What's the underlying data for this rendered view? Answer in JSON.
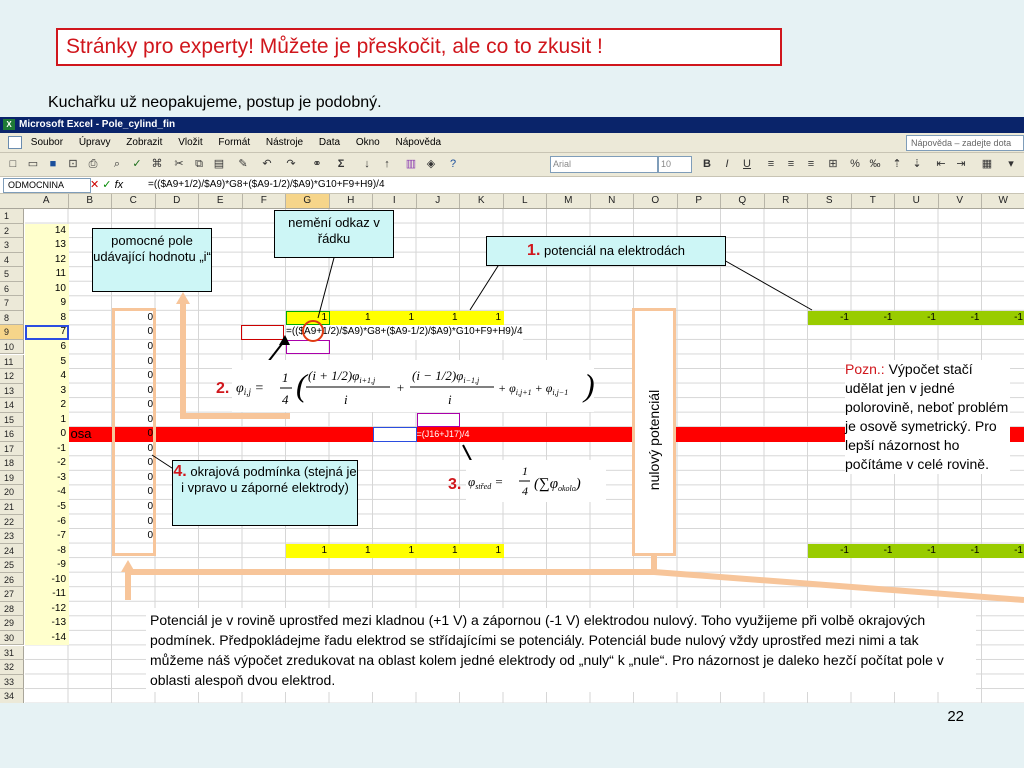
{
  "slide": {
    "title": "Stránky pro experty! Můžete je přeskočit, ale co to zkusit !",
    "subtitle": "Kuchařku už neopakujeme, postup je podobný.",
    "page_number": "22"
  },
  "excel": {
    "window_title": "Microsoft Excel - Pole_cylind_fin",
    "menu": [
      "Soubor",
      "Úpravy",
      "Zobrazit",
      "Vložit",
      "Formát",
      "Nástroje",
      "Data",
      "Okno",
      "Nápověda"
    ],
    "help_placeholder": "Nápověda – zadejte dota",
    "font_name": "Arial",
    "font_size": "10",
    "name_box": "ODMOCNINA",
    "formula": "=(($A9+1/2)/$A9)*G8+($A9-1/2)/$A9)*G10+F9+H9)/4",
    "columns": [
      "A",
      "B",
      "C",
      "D",
      "E",
      "F",
      "G",
      "H",
      "I",
      "J",
      "K",
      "L",
      "M",
      "N",
      "O",
      "P",
      "Q",
      "R",
      "S",
      "T",
      "U",
      "V",
      "W"
    ],
    "rows": [
      "1",
      "2",
      "3",
      "4",
      "5",
      "6",
      "7",
      "8",
      "9",
      "10",
      "11",
      "12",
      "13",
      "14",
      "15",
      "16",
      "17",
      "18",
      "19",
      "20",
      "21",
      "22",
      "23",
      "24",
      "25",
      "26",
      "27",
      "28",
      "29",
      "30",
      "31",
      "32",
      "33",
      "34"
    ],
    "col_a_values": [
      "",
      "14",
      "13",
      "12",
      "11",
      "10",
      "9",
      "8",
      "7",
      "6",
      "5",
      "4",
      "3",
      "2",
      "1",
      "0",
      "-1",
      "-2",
      "-3",
      "-4",
      "-5",
      "-6",
      "-7",
      "-8",
      "-9",
      "-10",
      "-11",
      "-12",
      "-13",
      "-14",
      "",
      "",
      "",
      ""
    ],
    "col_c_values": [
      "",
      "",
      "",
      "",
      "",
      "",
      "",
      "0",
      "0",
      "0",
      "0",
      "0",
      "0",
      "0",
      "0",
      "0",
      "0",
      "0",
      "0",
      "0",
      "0",
      "0",
      "0",
      "",
      "",
      "",
      "",
      "",
      "",
      "",
      "",
      "",
      "",
      ""
    ],
    "row8_ones": [
      "1",
      "1",
      "1",
      "1",
      "1"
    ],
    "row24_ones": [
      "1",
      "1",
      "1",
      "1",
      "1"
    ],
    "row8_minus": [
      "-1",
      "-1",
      "-1",
      "-1",
      "-1"
    ],
    "row24_minus": [
      "-1",
      "-1",
      "-1",
      "-1",
      "-1"
    ],
    "osa_label": "osa",
    "g9_formula": "=(($A9+1/2)/$A9)*G8+($A9-1/2)/$A9)*G10+F9+H9)/4",
    "j16_formula": "=(J16+J17)/4"
  },
  "annotations": {
    "helper": "pomocné pole udávající hodnotu „i“",
    "row_ref": "nemění odkaz v řádku",
    "potential_num": "1.",
    "potential": "potenciál na elektrodách",
    "eq2_num": "2.",
    "eq3_num": "3.",
    "boundary_num": "4.",
    "boundary": "okrajová podmínka (stejná je i vpravo u záporné elektrody)",
    "zero_potential": "nulový potenciál",
    "note_label": "Pozn.:",
    "note": "Výpočet stačí udělat jen v jedné polorovině, neboť problém je osově symetrický. Pro lepší názornost ho počítáme v celé rovině.",
    "bottom_text": "Potenciál je v rovině uprostřed mezi kladnou (+1 V) a zápornou (-1 V) elektrodou nulový. Toho využijeme při volbě okrajových podmínek. Předpokládejme řadu elektrod se střídajícími se potenciály. Potenciál bude nulový vždy uprostřed mezi nimi a tak můžeme náš výpočet zredukovat na oblast kolem jedné elektrody od „nuly“ k „nule“.  Pro názornost je daleko hezčí počítat pole v oblasti alespoň dvou elektrod."
  },
  "colors": {
    "title_red": "#d0161c",
    "yellow": "#ffff00",
    "green": "#99cc00",
    "axis_red": "#ff0000",
    "callout": "#cdf6f6",
    "orange": "#f7c59a"
  }
}
